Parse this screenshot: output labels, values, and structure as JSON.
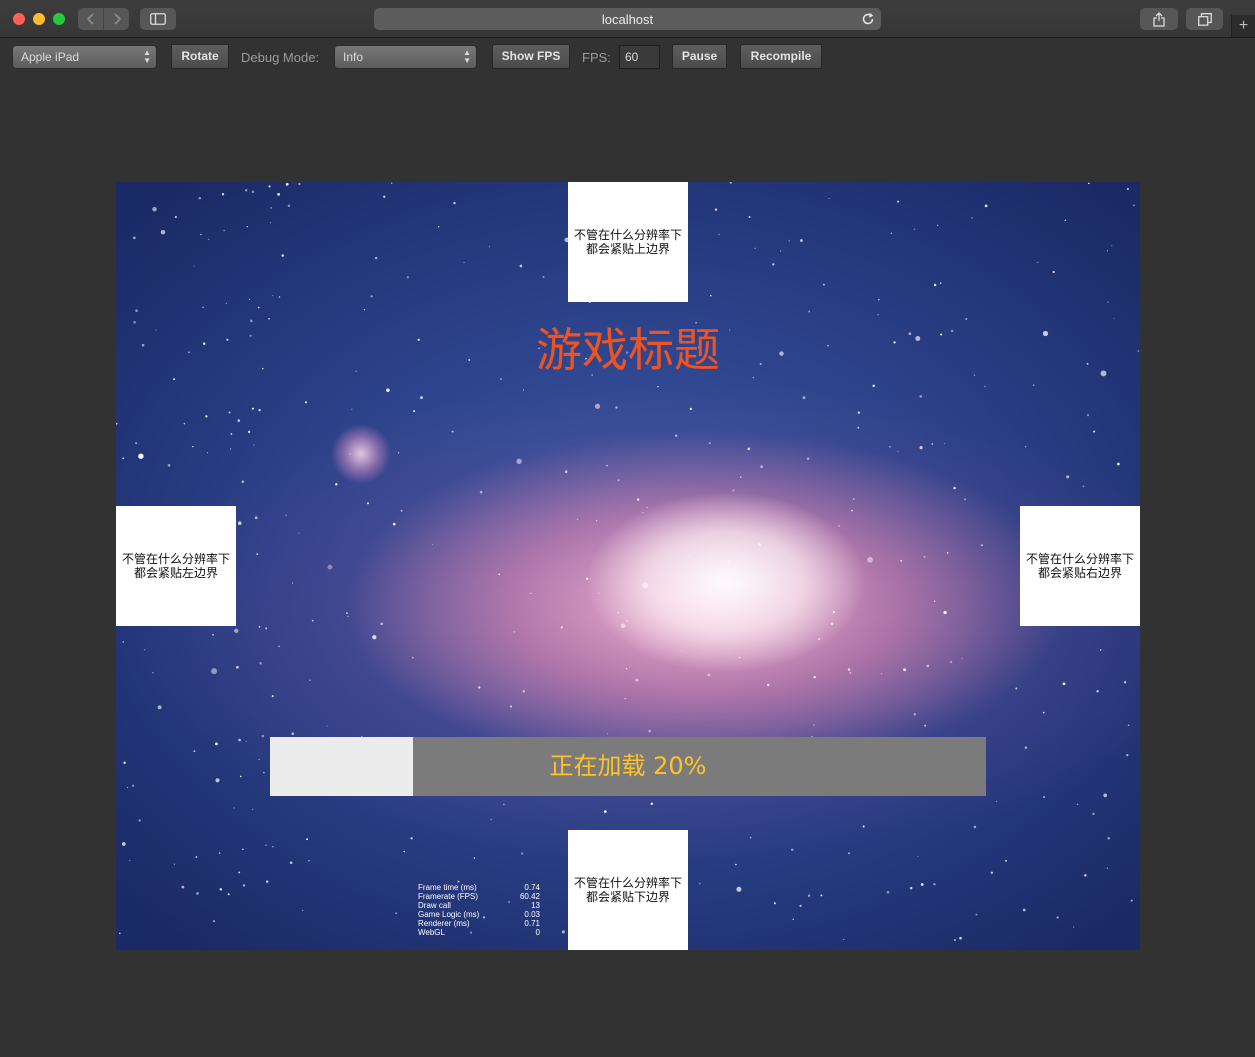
{
  "browser": {
    "address": "localhost",
    "new_tab_symbol": "+"
  },
  "toolbar": {
    "device_select": "Apple iPad",
    "rotate_label": "Rotate",
    "debug_mode_label": "Debug Mode:",
    "debug_mode_value": "Info",
    "show_fps_label": "Show FPS",
    "fps_label": "FPS:",
    "fps_value": "60",
    "pause_label": "Pause",
    "recompile_label": "Recompile"
  },
  "game": {
    "title": "游戏标题",
    "top_widget": "不管在什么分辨率下\n都会紧贴上边界",
    "left_widget": "不管在什么分辨率下\n都会紧贴左边界",
    "right_widget": "不管在什么分辨率下\n都会紧贴右边界",
    "bottom_widget": "不管在什么分辨率下\n都会紧贴下边界",
    "loading_text": "正在加载 20%",
    "loading_progress": 0.2,
    "title_color": "#ef5322",
    "loading_text_color": "#ffc22a"
  },
  "stats": [
    {
      "label": "Frame time (ms)",
      "value": "0.74"
    },
    {
      "label": "Framerate (FPS)",
      "value": "60.42"
    },
    {
      "label": "Draw call",
      "value": "13"
    },
    {
      "label": "Game Logic (ms)",
      "value": "0.03"
    },
    {
      "label": "Renderer (ms)",
      "value": "0.71"
    },
    {
      "label": "WebGL",
      "value": "0"
    }
  ]
}
